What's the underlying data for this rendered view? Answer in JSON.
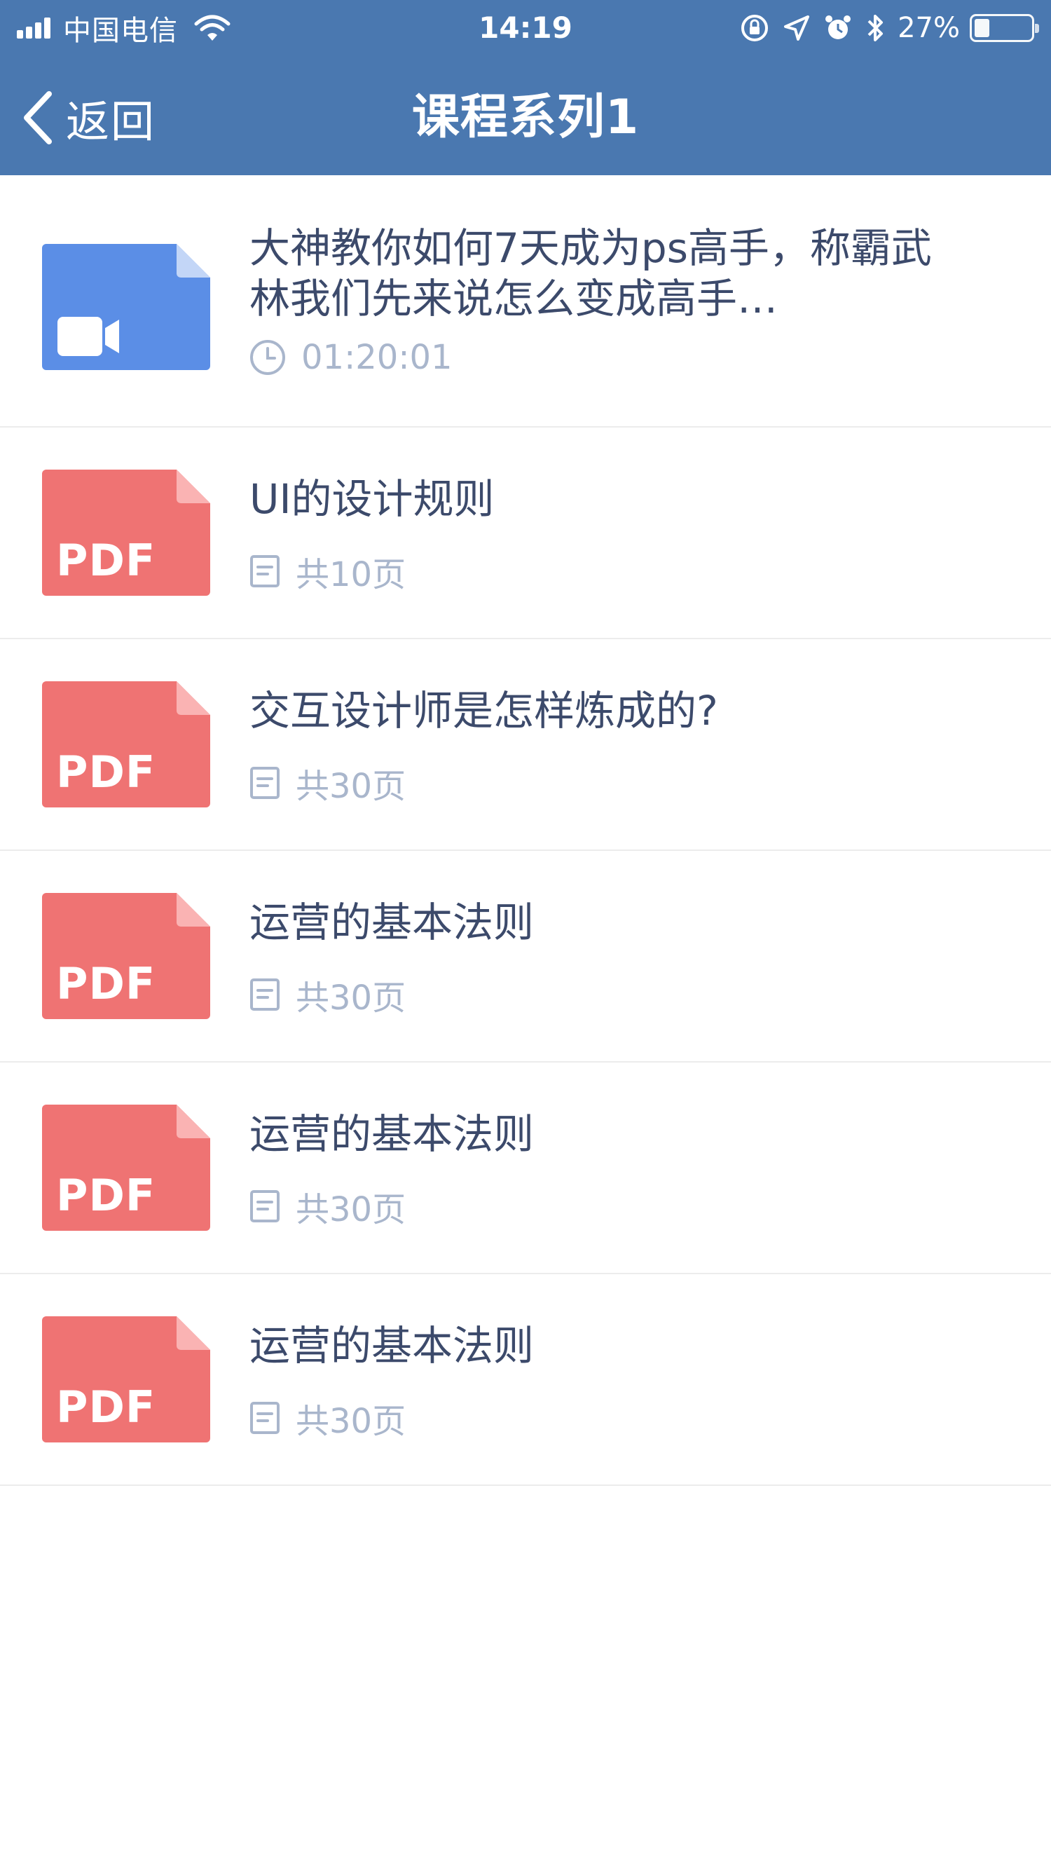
{
  "status_bar": {
    "carrier": "中国电信",
    "time": "14:19",
    "battery_percent": "27%",
    "battery_level": 0.27
  },
  "nav": {
    "back_label": "返回",
    "title": "课程系列1"
  },
  "items": [
    {
      "type": "video",
      "title": "大神教你如何7天成为ps高手，称霸武林我们先来说怎么变成高手…",
      "meta": "01:20:01",
      "thumb_label": ""
    },
    {
      "type": "pdf",
      "title": "UI的设计规则",
      "meta": "共10页",
      "thumb_label": "PDF"
    },
    {
      "type": "pdf",
      "title": "交互设计师是怎样炼成的?",
      "meta": "共30页",
      "thumb_label": "PDF"
    },
    {
      "type": "pdf",
      "title": "运营的基本法则",
      "meta": "共30页",
      "thumb_label": "PDF"
    },
    {
      "type": "pdf",
      "title": "运营的基本法则",
      "meta": "共30页",
      "thumb_label": "PDF"
    },
    {
      "type": "pdf",
      "title": "运营的基本法则",
      "meta": "共30页",
      "thumb_label": "PDF"
    }
  ],
  "colors": {
    "header": "#4a78b0",
    "video_icon": "#5b8ee6",
    "pdf_icon": "#ef7373",
    "title_text": "#3c4a6b",
    "meta_text": "#a9b6cc"
  },
  "icons": {
    "video": "video-camera-icon",
    "pdf": "pdf-file-icon",
    "duration": "clock-icon",
    "pages": "document-page-icon"
  }
}
